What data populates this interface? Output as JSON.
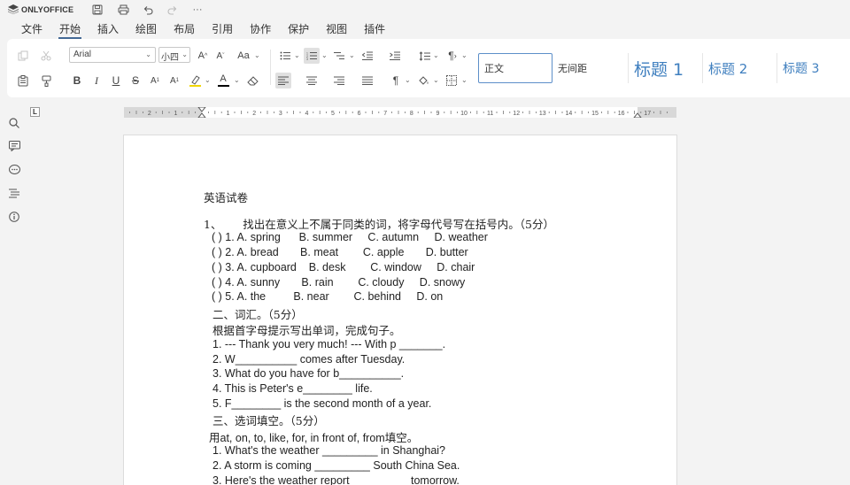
{
  "app": {
    "brand": "ONLYOFFICE",
    "more": "···"
  },
  "menu": {
    "tabs": [
      "文件",
      "开始",
      "插入",
      "绘图",
      "布局",
      "引用",
      "协作",
      "保护",
      "视图",
      "插件"
    ],
    "active_index": 1
  },
  "toolbar": {
    "font_name": "Arial",
    "font_size": "小四",
    "increase_font": "A",
    "decrease_font": "A",
    "change_case": "Aa",
    "bold": "B",
    "italic": "I",
    "underline": "U",
    "strike": "S",
    "superscript": "A",
    "subscript": "A",
    "pilcrow": "¶",
    "highlight_color": "#f2d600",
    "font_color": "#000000",
    "accent": "#446995"
  },
  "styles": {
    "items": [
      "正文",
      "无间距",
      "标题 1",
      "标题 2",
      "标题 3"
    ],
    "selected_index": 0,
    "heading_color": "#3f7fbf"
  },
  "ruler": {
    "corner": "L",
    "numbers": [
      "2",
      "1",
      "1",
      "2",
      "3",
      "4",
      "5",
      "6",
      "7",
      "8",
      "9",
      "10",
      "11",
      "12",
      "13",
      "14",
      "15",
      "16",
      "17"
    ]
  },
  "document": {
    "lines": [
      "英语试卷",
      "1、      找出在意义上不属于同类的词，将字母代号写在括号内。（5分）",
      "( ) 1. A. spring      B. summer     C. autumn     D. weather",
      "( ) 2. A. bread       B. meat        C. apple       D. butter",
      "( ) 3. A. cupboard    B. desk        C. window     D. chair",
      "( ) 4. A. sunny       B. rain        C. cloudy     D. snowy",
      "( ) 5. A. the         B. near        C. behind     D. on",
      "二、词汇。（5分）",
      "根据首字母提示写出单词，完成句子。",
      "1. --- Thank you very much! --- With p _______.",
      "2. W__________ comes after Tuesday.",
      "3. What do you have for b__________.",
      "4. This is Peter's e________ life.",
      "5. F________ is the second month of a year.",
      "三、选词填空。（5分）",
      "用at, on, to, like, for, in front of, from填空。",
      "1. What's the weather _________ in Shanghai?",
      "2. A storm is coming _________ South China Sea.",
      "3. Here's the weather report                    tomorrow."
    ]
  }
}
